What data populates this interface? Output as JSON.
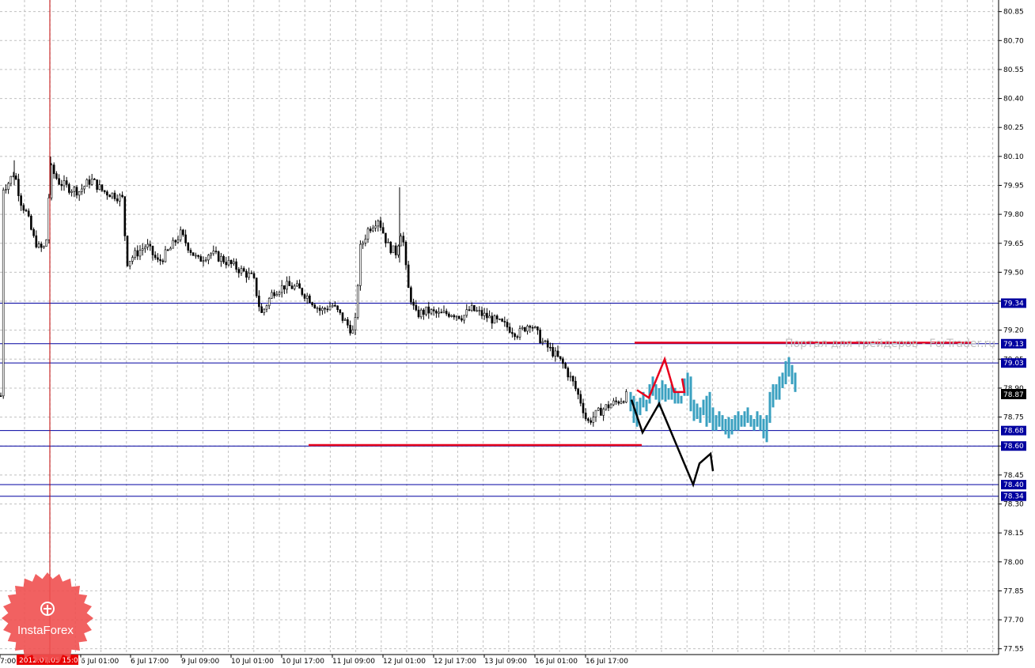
{
  "chart_data": {
    "type": "candlestick",
    "title": "",
    "xlabel": "",
    "ylabel": "",
    "ylim": [
      77.52,
      80.91
    ],
    "yticks": [
      80.85,
      80.7,
      80.55,
      80.4,
      80.25,
      80.1,
      79.95,
      79.8,
      79.65,
      79.5,
      79.35,
      79.2,
      79.05,
      78.9,
      78.75,
      78.6,
      78.45,
      78.3,
      78.15,
      78.0,
      77.85,
      77.7,
      77.55
    ],
    "ytick_labels": [
      "80.85",
      "80.70",
      "80.55",
      "80.40",
      "80.25",
      "80.10",
      "79.95",
      "79.80",
      "79.65",
      "79.50",
      "79.35",
      "79.20",
      "79.05",
      "78.90",
      "78.75",
      "78.60",
      "78.45",
      "78.30",
      "78.15",
      "78.00",
      "77.85",
      "77.70",
      "77.55"
    ],
    "xtick_labels": [
      "7:00",
      "6 Jul 01:00",
      "6 Jul 17:00",
      "9 Jul 09:00",
      "10 Jul 01:00",
      "10 Jul 17:00",
      "11 Jul 09:00",
      "12 Jul 01:00",
      "12 Jul 17:00",
      "13 Jul 09:00",
      "16 Jul 01:00",
      "16 Jul 17:00"
    ],
    "highlighted_time": "2012.07.05 15:00",
    "current_price": "78.87",
    "grid": true,
    "levels": [
      {
        "value": 79.34,
        "label": "79.34",
        "color": "#0000a0"
      },
      {
        "value": 79.13,
        "label": "79.13",
        "color": "#0000a0"
      },
      {
        "value": 79.03,
        "label": "79.03",
        "color": "#0000a0"
      },
      {
        "value": 78.68,
        "label": "78.68",
        "color": "#0000a0"
      },
      {
        "value": 78.6,
        "label": "78.60",
        "color": "#0000a0"
      },
      {
        "value": 78.4,
        "label": "78.40",
        "color": "#0000a0"
      },
      {
        "value": 78.34,
        "label": "78.34",
        "color": "#0000a0"
      }
    ],
    "segments": [
      {
        "name": "resistance-line",
        "color": "#e8001c",
        "x": [
          802,
          1228
        ],
        "y": [
          79.135,
          79.135
        ]
      },
      {
        "name": "support-line",
        "color": "#e8001c",
        "x": [
          390,
          811
        ],
        "y": [
          78.605,
          78.605
        ]
      },
      {
        "name": "forecast-red-zigzag",
        "color": "#e8001c",
        "x": [
          805,
          820,
          840,
          852,
          865,
          862
        ],
        "y": [
          78.89,
          78.85,
          79.05,
          78.88,
          78.88,
          78.95
        ]
      },
      {
        "name": "forecast-black-zigzag",
        "color": "#000000",
        "x": [
          798,
          812,
          833,
          876,
          884,
          898,
          901
        ],
        "y": [
          78.84,
          78.67,
          78.82,
          78.4,
          78.51,
          78.56,
          78.47
        ]
      }
    ],
    "colors": {
      "grid": "#c0c0c0",
      "candles": "#000000",
      "projection": "#3aa0c0",
      "marker_line": "#c00000"
    }
  },
  "watermark": "Портал для трейдеров - ForTrader.ru",
  "logo": {
    "text": "InstaForex",
    "color": "#f05050"
  }
}
